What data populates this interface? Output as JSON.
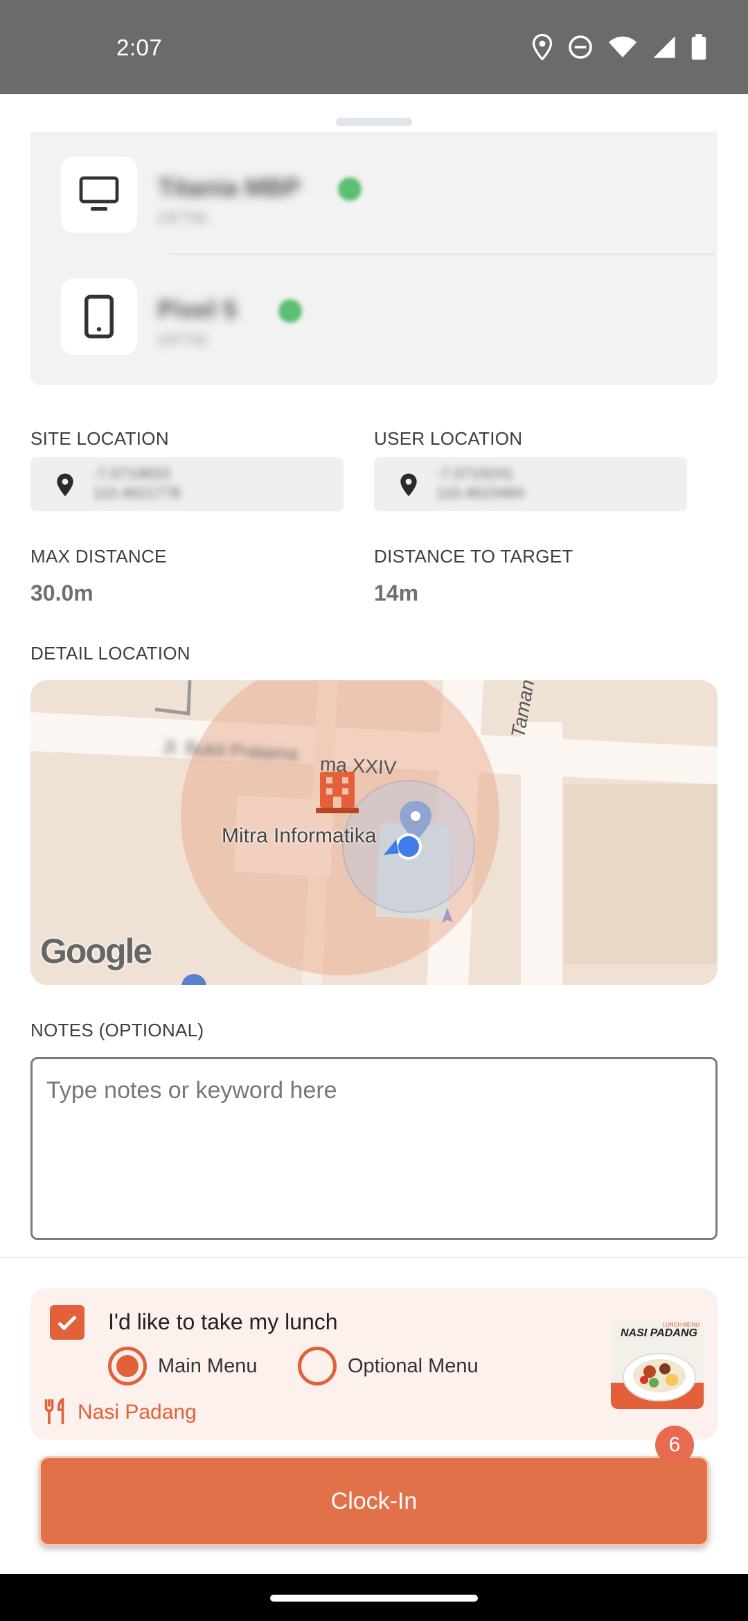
{
  "status_bar": {
    "time": "2:07",
    "icons": [
      "location-icon",
      "do-not-disturb-icon",
      "wifi-icon",
      "cellular-signal-icon",
      "battery-icon"
    ]
  },
  "devices": [
    {
      "name": "Titania MBP",
      "sub": "OFTW",
      "icon": "monitor-icon",
      "status": "online"
    },
    {
      "name": "Pixel 5",
      "sub": "OFTW",
      "icon": "phone-icon",
      "status": "online"
    }
  ],
  "site_location": {
    "label": "SITE LOCATION",
    "line1": "-7.0719833",
    "line2": "110.4621778"
  },
  "user_location": {
    "label": "USER LOCATION",
    "line1": "-7.0719241",
    "line2": "110.4623484"
  },
  "max_distance": {
    "label": "MAX DISTANCE",
    "value": "30.0m"
  },
  "distance_to_target": {
    "label": "DISTANCE TO TARGET",
    "value": "14m"
  },
  "detail_location": {
    "label": "DETAIL LOCATION",
    "map": {
      "place_label": "Mitra Informatika",
      "street_top": "ma XXIV",
      "street_blurred": "Jl. Bukit Pratama",
      "street_right": "Taman Pra",
      "logo": "Google"
    }
  },
  "notes": {
    "label": "NOTES (OPTIONAL)",
    "placeholder": "Type notes or keyword here"
  },
  "lunch": {
    "title": "I'd like to take my lunch",
    "checked": true,
    "options": [
      {
        "label": "Main Menu",
        "selected": true
      },
      {
        "label": "Optional Menu",
        "selected": false
      }
    ],
    "selected_food": "Nasi Padang",
    "thumb_title": "NASI PADANG",
    "thumb_tag": "LUNCH MENU"
  },
  "clock_in": {
    "label": "Clock-In",
    "badge": "6"
  },
  "colors": {
    "accent": "#e2603a",
    "button": "#e27049",
    "card_bg": "#fcf1ec",
    "status_bar": "#6b6b6b"
  }
}
